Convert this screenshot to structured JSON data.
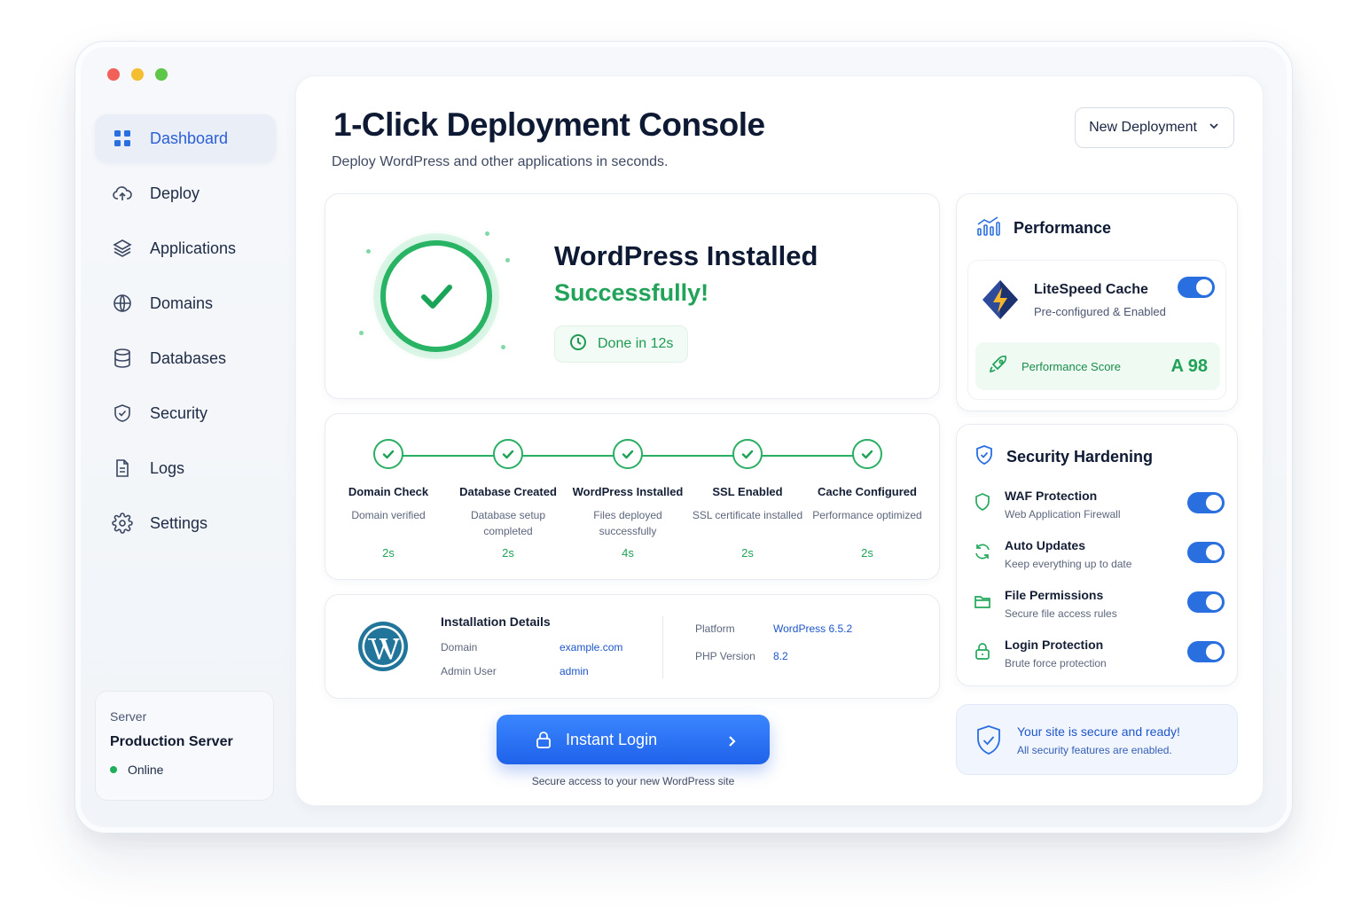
{
  "sidebar": {
    "items": [
      {
        "label": "Dashboard",
        "icon": "grid-icon",
        "active": true
      },
      {
        "label": "Deploy",
        "icon": "cloud-upload-icon"
      },
      {
        "label": "Applications",
        "icon": "layers-icon"
      },
      {
        "label": "Domains",
        "icon": "globe-icon"
      },
      {
        "label": "Databases",
        "icon": "database-icon"
      },
      {
        "label": "Security",
        "icon": "shield-check-icon"
      },
      {
        "label": "Logs",
        "icon": "document-icon"
      },
      {
        "label": "Settings",
        "icon": "gear-icon"
      }
    ],
    "server": {
      "label": "Server",
      "name": "Production Server",
      "status": "Online",
      "status_color": "#1fae59"
    }
  },
  "header": {
    "title": "1-Click Deployment Console",
    "subtitle": "Deploy WordPress and other applications in seconds.",
    "new_deployment_label": "New Deployment"
  },
  "success": {
    "title": "WordPress Installed",
    "subtitle": "Successfully!",
    "done_label": "Done in 12s"
  },
  "steps": [
    {
      "name": "Domain Check",
      "desc": "Domain verified",
      "time": "2s"
    },
    {
      "name": "Database Created",
      "desc": "Database setup completed",
      "time": "2s"
    },
    {
      "name": "WordPress Installed",
      "desc": "Files deployed successfully",
      "time": "4s"
    },
    {
      "name": "SSL Enabled",
      "desc": "SSL certificate installed",
      "time": "2s"
    },
    {
      "name": "Cache Configured",
      "desc": "Performance optimized",
      "time": "2s"
    }
  ],
  "install": {
    "header": "Installation Details",
    "domain_label": "Domain",
    "domain_value": "example.com",
    "admin_label": "Admin User",
    "admin_value": "admin",
    "platform_label": "Platform",
    "platform_value": "WordPress 6.5.2",
    "php_label": "PHP Version",
    "php_value": "8.2"
  },
  "login": {
    "button_label": "Instant Login",
    "note": "Secure access to your new WordPress site"
  },
  "performance": {
    "title": "Performance",
    "plugin_name": "LiteSpeed Cache",
    "plugin_desc": "Pre-configured & Enabled",
    "plugin_enabled": true,
    "score_label": "Performance Score",
    "score_value": "A 98"
  },
  "security": {
    "title": "Security Hardening",
    "items": [
      {
        "name": "WAF Protection",
        "desc": "Web Application Firewall",
        "icon": "shield-icon",
        "enabled": true
      },
      {
        "name": "Auto Updates",
        "desc": "Keep everything up to date",
        "icon": "refresh-icon",
        "enabled": true
      },
      {
        "name": "File Permissions",
        "desc": "Secure file access rules",
        "icon": "folder-icon",
        "enabled": true
      },
      {
        "name": "Login Protection",
        "desc": "Brute force protection",
        "icon": "lock-icon",
        "enabled": true
      }
    ],
    "note_title": "Your site is secure and ready!",
    "note_desc": "All security features are enabled."
  },
  "colors": {
    "accent": "#2a6fe0",
    "success": "#22a35a"
  }
}
